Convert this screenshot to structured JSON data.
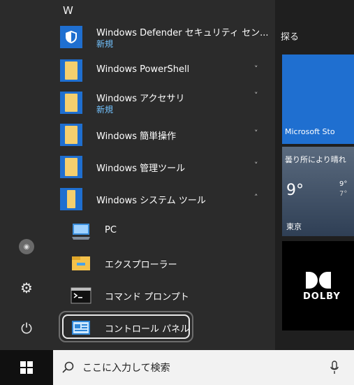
{
  "app_list": {
    "letter": "W",
    "items": [
      {
        "label": "Windows Defender セキュリティ セン...",
        "badge": "新規",
        "icon": "shield-icon",
        "expand": ""
      },
      {
        "label": "Windows PowerShell",
        "badge": "",
        "icon": "folder-icon",
        "expand": "˅"
      },
      {
        "label": "Windows アクセサリ",
        "badge": "新規",
        "icon": "folder-icon",
        "expand": "˅"
      },
      {
        "label": "Windows 簡単操作",
        "badge": "",
        "icon": "folder-icon",
        "expand": "˅"
      },
      {
        "label": "Windows 管理ツール",
        "badge": "",
        "icon": "folder-icon",
        "expand": "˅"
      },
      {
        "label": "Windows システム ツール",
        "badge": "",
        "icon": "folder-icon",
        "expand": "˄"
      }
    ],
    "sub_items": [
      {
        "label": "PC",
        "icon": "pc-icon"
      },
      {
        "label": "エクスプローラー",
        "icon": "file-explorer-icon"
      },
      {
        "label": "コマンド プロンプト",
        "icon": "command-prompt-icon"
      },
      {
        "label": "コントロール パネル",
        "icon": "control-panel-icon"
      }
    ]
  },
  "tiles": {
    "explore": "探る",
    "store": "Microsoft Sto",
    "weather_desc": "曇り所により晴れ",
    "temp": "9°",
    "temp_high": "9°",
    "temp_low": "7°",
    "city": "東京",
    "dolby": "DOLBY"
  },
  "search": {
    "placeholder": "ここに入力して検索"
  },
  "colors": {
    "accent": "#1f6fd0",
    "folder": "#f5cf6e",
    "badge": "#73c3ff",
    "highlight": "#e8e8e8"
  }
}
